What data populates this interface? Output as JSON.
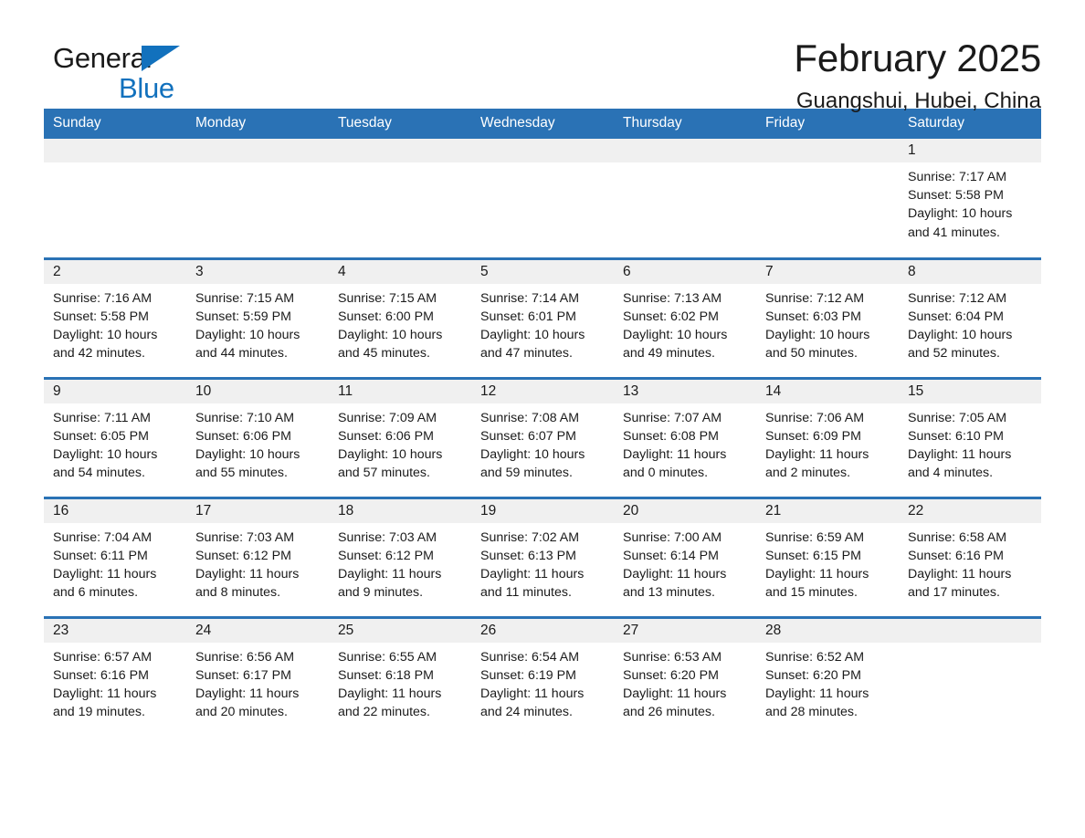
{
  "brand": {
    "line1": "General",
    "line2": "Blue",
    "accent_color": "#1271bd",
    "triangle_icon": "triangle-icon"
  },
  "header": {
    "title": "February 2025",
    "subtitle": "Guangshui, Hubei, China"
  },
  "colors": {
    "header_blue": "#2a72b5",
    "daynum_band": "#f0f0f0",
    "text": "#1a1a1a"
  },
  "calendar": {
    "weekday_headers": [
      "Sunday",
      "Monday",
      "Tuesday",
      "Wednesday",
      "Thursday",
      "Friday",
      "Saturday"
    ],
    "labels": {
      "sunrise": "Sunrise:",
      "sunset": "Sunset:",
      "daylight": "Daylight:"
    },
    "weeks": [
      [
        {
          "empty": true
        },
        {
          "empty": true
        },
        {
          "empty": true
        },
        {
          "empty": true
        },
        {
          "empty": true
        },
        {
          "empty": true
        },
        {
          "day": "1",
          "sunrise": "Sunrise: 7:17 AM",
          "sunset": "Sunset: 5:58 PM",
          "daylight": "Daylight: 10 hours and 41 minutes."
        }
      ],
      [
        {
          "day": "2",
          "sunrise": "Sunrise: 7:16 AM",
          "sunset": "Sunset: 5:58 PM",
          "daylight": "Daylight: 10 hours and 42 minutes."
        },
        {
          "day": "3",
          "sunrise": "Sunrise: 7:15 AM",
          "sunset": "Sunset: 5:59 PM",
          "daylight": "Daylight: 10 hours and 44 minutes."
        },
        {
          "day": "4",
          "sunrise": "Sunrise: 7:15 AM",
          "sunset": "Sunset: 6:00 PM",
          "daylight": "Daylight: 10 hours and 45 minutes."
        },
        {
          "day": "5",
          "sunrise": "Sunrise: 7:14 AM",
          "sunset": "Sunset: 6:01 PM",
          "daylight": "Daylight: 10 hours and 47 minutes."
        },
        {
          "day": "6",
          "sunrise": "Sunrise: 7:13 AM",
          "sunset": "Sunset: 6:02 PM",
          "daylight": "Daylight: 10 hours and 49 minutes."
        },
        {
          "day": "7",
          "sunrise": "Sunrise: 7:12 AM",
          "sunset": "Sunset: 6:03 PM",
          "daylight": "Daylight: 10 hours and 50 minutes."
        },
        {
          "day": "8",
          "sunrise": "Sunrise: 7:12 AM",
          "sunset": "Sunset: 6:04 PM",
          "daylight": "Daylight: 10 hours and 52 minutes."
        }
      ],
      [
        {
          "day": "9",
          "sunrise": "Sunrise: 7:11 AM",
          "sunset": "Sunset: 6:05 PM",
          "daylight": "Daylight: 10 hours and 54 minutes."
        },
        {
          "day": "10",
          "sunrise": "Sunrise: 7:10 AM",
          "sunset": "Sunset: 6:06 PM",
          "daylight": "Daylight: 10 hours and 55 minutes."
        },
        {
          "day": "11",
          "sunrise": "Sunrise: 7:09 AM",
          "sunset": "Sunset: 6:06 PM",
          "daylight": "Daylight: 10 hours and 57 minutes."
        },
        {
          "day": "12",
          "sunrise": "Sunrise: 7:08 AM",
          "sunset": "Sunset: 6:07 PM",
          "daylight": "Daylight: 10 hours and 59 minutes."
        },
        {
          "day": "13",
          "sunrise": "Sunrise: 7:07 AM",
          "sunset": "Sunset: 6:08 PM",
          "daylight": "Daylight: 11 hours and 0 minutes."
        },
        {
          "day": "14",
          "sunrise": "Sunrise: 7:06 AM",
          "sunset": "Sunset: 6:09 PM",
          "daylight": "Daylight: 11 hours and 2 minutes."
        },
        {
          "day": "15",
          "sunrise": "Sunrise: 7:05 AM",
          "sunset": "Sunset: 6:10 PM",
          "daylight": "Daylight: 11 hours and 4 minutes."
        }
      ],
      [
        {
          "day": "16",
          "sunrise": "Sunrise: 7:04 AM",
          "sunset": "Sunset: 6:11 PM",
          "daylight": "Daylight: 11 hours and 6 minutes."
        },
        {
          "day": "17",
          "sunrise": "Sunrise: 7:03 AM",
          "sunset": "Sunset: 6:12 PM",
          "daylight": "Daylight: 11 hours and 8 minutes."
        },
        {
          "day": "18",
          "sunrise": "Sunrise: 7:03 AM",
          "sunset": "Sunset: 6:12 PM",
          "daylight": "Daylight: 11 hours and 9 minutes."
        },
        {
          "day": "19",
          "sunrise": "Sunrise: 7:02 AM",
          "sunset": "Sunset: 6:13 PM",
          "daylight": "Daylight: 11 hours and 11 minutes."
        },
        {
          "day": "20",
          "sunrise": "Sunrise: 7:00 AM",
          "sunset": "Sunset: 6:14 PM",
          "daylight": "Daylight: 11 hours and 13 minutes."
        },
        {
          "day": "21",
          "sunrise": "Sunrise: 6:59 AM",
          "sunset": "Sunset: 6:15 PM",
          "daylight": "Daylight: 11 hours and 15 minutes."
        },
        {
          "day": "22",
          "sunrise": "Sunrise: 6:58 AM",
          "sunset": "Sunset: 6:16 PM",
          "daylight": "Daylight: 11 hours and 17 minutes."
        }
      ],
      [
        {
          "day": "23",
          "sunrise": "Sunrise: 6:57 AM",
          "sunset": "Sunset: 6:16 PM",
          "daylight": "Daylight: 11 hours and 19 minutes."
        },
        {
          "day": "24",
          "sunrise": "Sunrise: 6:56 AM",
          "sunset": "Sunset: 6:17 PM",
          "daylight": "Daylight: 11 hours and 20 minutes."
        },
        {
          "day": "25",
          "sunrise": "Sunrise: 6:55 AM",
          "sunset": "Sunset: 6:18 PM",
          "daylight": "Daylight: 11 hours and 22 minutes."
        },
        {
          "day": "26",
          "sunrise": "Sunrise: 6:54 AM",
          "sunset": "Sunset: 6:19 PM",
          "daylight": "Daylight: 11 hours and 24 minutes."
        },
        {
          "day": "27",
          "sunrise": "Sunrise: 6:53 AM",
          "sunset": "Sunset: 6:20 PM",
          "daylight": "Daylight: 11 hours and 26 minutes."
        },
        {
          "day": "28",
          "sunrise": "Sunrise: 6:52 AM",
          "sunset": "Sunset: 6:20 PM",
          "daylight": "Daylight: 11 hours and 28 minutes."
        },
        {
          "empty": true
        }
      ]
    ]
  }
}
